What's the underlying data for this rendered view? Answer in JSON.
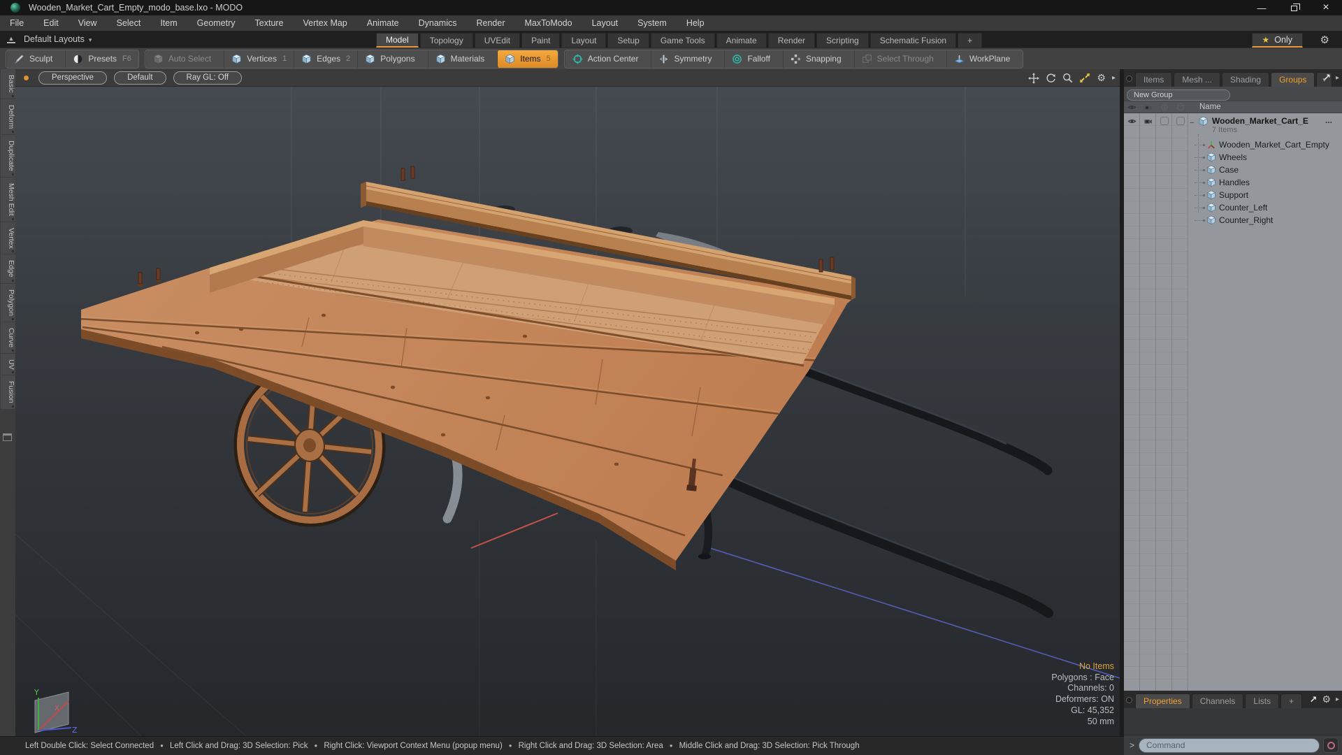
{
  "window": {
    "title": "Wooden_Market_Cart_Empty_modo_base.lxo - MODO",
    "controls": {
      "minimize": "—",
      "close": "×"
    }
  },
  "icons": {
    "gear": "⚙",
    "star": "★",
    "dropdown": "▾",
    "arrow_right": "▸",
    "expand": "↗",
    "plus": "+",
    "minus": "−",
    "ellipsis": "..."
  },
  "menu": {
    "items": [
      "File",
      "Edit",
      "View",
      "Select",
      "Item",
      "Geometry",
      "Texture",
      "Vertex Map",
      "Animate",
      "Dynamics",
      "Render",
      "MaxToModo",
      "Layout",
      "System",
      "Help"
    ]
  },
  "layout_bar": {
    "switcher": "Default Layouts",
    "tabs": [
      {
        "label": "Model",
        "state": "active"
      },
      {
        "label": "Topology"
      },
      {
        "label": "UVEdit"
      },
      {
        "label": "Paint"
      },
      {
        "label": "Layout"
      },
      {
        "label": "Setup"
      },
      {
        "label": "Game Tools"
      },
      {
        "label": "Animate"
      },
      {
        "label": "Render"
      },
      {
        "label": "Scripting"
      },
      {
        "label": "Schematic Fusion"
      },
      {
        "label": "+"
      }
    ],
    "only_label": "Only"
  },
  "toolbar": {
    "groups": [
      {
        "buttons": [
          {
            "label": "Sculpt",
            "icon": "pencil"
          },
          {
            "label": "Presets",
            "suffix": "F6",
            "icon": "sphere"
          }
        ]
      },
      {
        "buttons": [
          {
            "label": "Auto Select",
            "icon": "cube-gray",
            "state": "disabled"
          },
          {
            "label": "Vertices",
            "suffix": "1",
            "icon": "cube"
          },
          {
            "label": "Edges",
            "suffix": "2",
            "icon": "cube"
          },
          {
            "label": "Polygons",
            "icon": "cube"
          },
          {
            "label": "Materials",
            "icon": "cube"
          },
          {
            "label": "Items",
            "suffix": "5",
            "icon": "cube",
            "state": "active"
          }
        ]
      },
      {
        "buttons": [
          {
            "label": "Action Center",
            "icon": "action"
          },
          {
            "label": "Symmetry",
            "icon": "symmetry"
          },
          {
            "label": "Falloff",
            "icon": "falloff"
          },
          {
            "label": "Snapping",
            "icon": "snapping"
          },
          {
            "label": "Select Through",
            "icon": "selthrough",
            "state": "disabled"
          },
          {
            "label": "WorkPlane",
            "icon": "workplane"
          }
        ]
      }
    ]
  },
  "side_tabs": {
    "items": [
      "Basic",
      "Deform",
      "Duplicate",
      "Mesh Edit",
      "Vertex",
      "Edge",
      "Polygon",
      "Curve",
      "UV",
      "Fusion"
    ]
  },
  "viewport": {
    "header": {
      "buttons": [
        "Perspective",
        "Default",
        "Ray GL: Off"
      ]
    },
    "info": {
      "no_items": "No Items",
      "selection_mode": "Polygons : Face",
      "channels": "Channels: 0",
      "deformers": "Deformers: ON",
      "gl": "GL: 45,352",
      "focal": "50 mm"
    },
    "axis_labels": {
      "x": "X",
      "y": "Y",
      "z": "Z"
    }
  },
  "right_panel": {
    "tabs": [
      {
        "label": "Items"
      },
      {
        "label": "Mesh ..."
      },
      {
        "label": "Shading"
      },
      {
        "label": "Groups",
        "state": "active"
      }
    ],
    "new_group_button": "New Group",
    "name_column": "Name",
    "group": {
      "name": "Wooden_Market_Cart_E",
      "count": "7 Items"
    },
    "items": [
      {
        "label": "Wooden_Market_Cart_Empty",
        "icon": "locator"
      },
      {
        "label": "Wheels",
        "icon": "cube"
      },
      {
        "label": "Case",
        "icon": "cube"
      },
      {
        "label": "Handles",
        "icon": "cube"
      },
      {
        "label": "Support",
        "icon": "cube"
      },
      {
        "label": "Counter_Left",
        "icon": "cube"
      },
      {
        "label": "Counter_Right",
        "icon": "cube"
      }
    ],
    "bottom_tabs": [
      {
        "label": "Properties",
        "state": "active"
      },
      {
        "label": "Channels"
      },
      {
        "label": "Lists"
      },
      {
        "label": "+"
      }
    ],
    "command": {
      "prompt": ">",
      "placeholder": "Command"
    }
  },
  "status_bar": {
    "segments": [
      "Left Double Click: Select Connected",
      "Left Click and Drag: 3D Selection: Pick",
      "Right Click: Viewport Context Menu (popup menu)",
      "Right Click and Drag: 3D Selection: Area",
      "Middle Click and Drag: 3D Selection: Pick Through"
    ]
  },
  "colors": {
    "accent_orange": "#e89b3c",
    "active_button": "#f0a030",
    "wood": "#c68a5e",
    "wood_dark": "#7c4c28",
    "handle_dark": "#17181b",
    "axis_red": "#c4524a",
    "axis_blue": "#5a62c2",
    "axis_green": "#3fae3f",
    "list_bg": "#94989c",
    "command_field": "#a7b4bf"
  }
}
